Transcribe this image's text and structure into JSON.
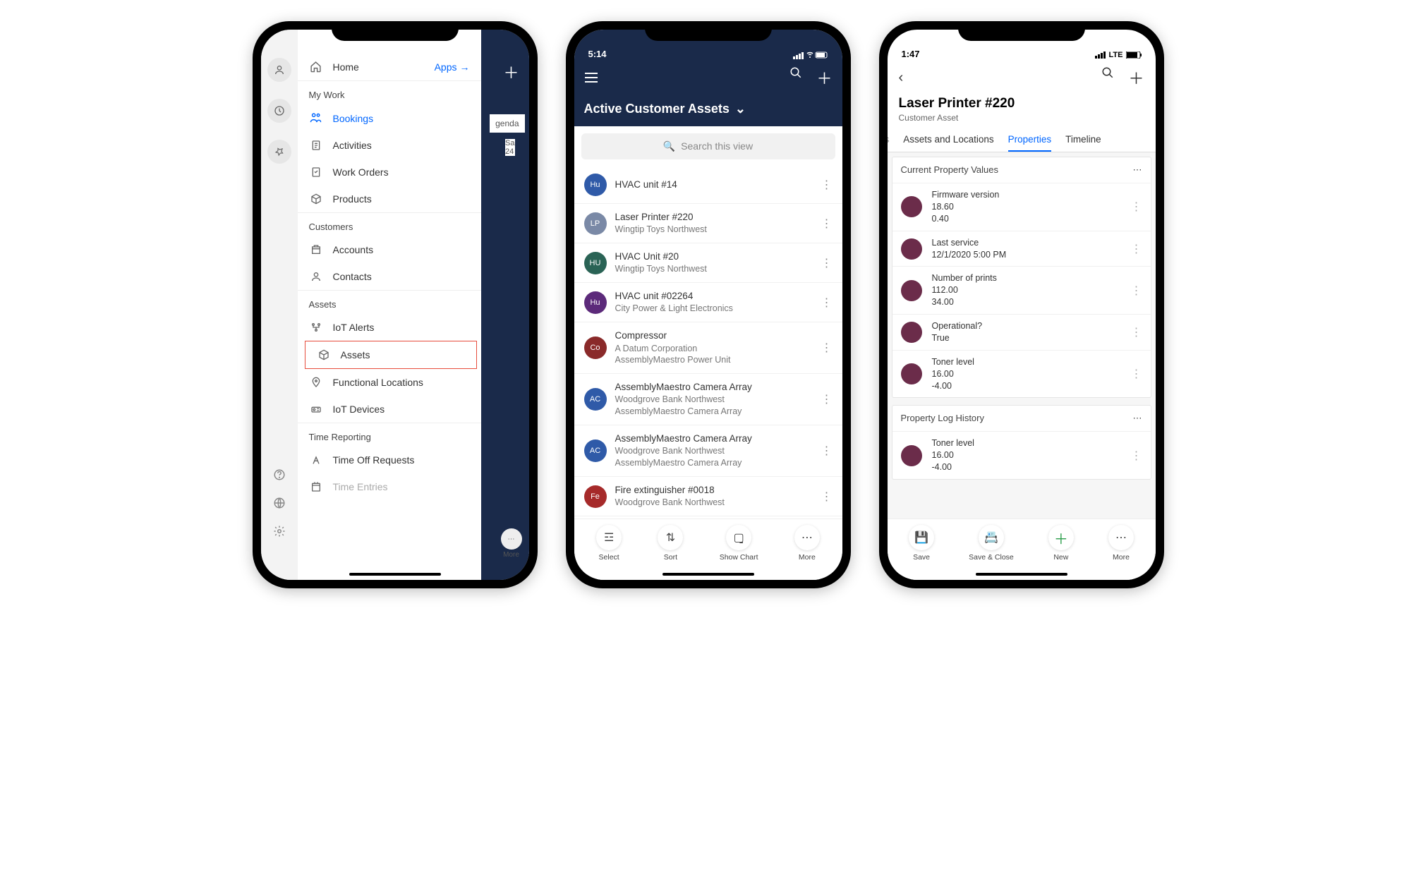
{
  "phone1": {
    "apps_link": "Apps",
    "drawer": {
      "top_item": "Home",
      "sections": [
        {
          "title": "My Work",
          "items": [
            "Bookings",
            "Activities",
            "Work Orders",
            "Products"
          ]
        },
        {
          "title": "Customers",
          "items": [
            "Accounts",
            "Contacts"
          ]
        },
        {
          "title": "Assets",
          "items": [
            "IoT Alerts",
            "Assets",
            "Functional Locations",
            "IoT Devices"
          ]
        },
        {
          "title": "Time Reporting",
          "items": [
            "Time Off Requests",
            "Time Entries"
          ]
        }
      ],
      "selected_item": "Bookings",
      "highlighted_item": "Assets"
    },
    "background": {
      "agenda": "genda",
      "sa": "Sa",
      "sa_num": "24",
      "more": "More"
    }
  },
  "phone2": {
    "status_time": "5:14",
    "title": "Active Customer Assets",
    "search_placeholder": "Search this view",
    "items": [
      {
        "avatar": "Hu",
        "color": "#2f5aa8",
        "title": "HVAC unit #14",
        "subtitle": ""
      },
      {
        "avatar": "LP",
        "color": "#7a89a6",
        "title": "Laser Printer #220",
        "subtitle": "Wingtip Toys Northwest"
      },
      {
        "avatar": "HU",
        "color": "#2a6355",
        "title": "HVAC Unit #20",
        "subtitle": "Wingtip Toys Northwest"
      },
      {
        "avatar": "Hu",
        "color": "#5c2a7a",
        "title": "HVAC unit #02264",
        "subtitle": "City Power & Light Electronics"
      },
      {
        "avatar": "Co",
        "color": "#8a2a2a",
        "title": "Compressor",
        "subtitle": "A Datum Corporation",
        "subtitle2": "AssemblyMaestro Power Unit"
      },
      {
        "avatar": "AC",
        "color": "#2f5aa8",
        "title": "AssemblyMaestro Camera Array",
        "subtitle": "Woodgrove Bank Northwest",
        "subtitle2": "AssemblyMaestro Camera Array"
      },
      {
        "avatar": "AC",
        "color": "#2f5aa8",
        "title": "AssemblyMaestro Camera Array",
        "subtitle": "Woodgrove Bank Northwest",
        "subtitle2": "AssemblyMaestro Camera Array"
      },
      {
        "avatar": "Fe",
        "color": "#a62a2a",
        "title": "Fire extinguisher #0018",
        "subtitle": "Woodgrove Bank Northwest"
      }
    ],
    "bottom_actions": [
      "Select",
      "Sort",
      "Show Chart",
      "More"
    ]
  },
  "phone3": {
    "status_time": "1:47",
    "status_net": "LTE",
    "title": "Laser Printer #220",
    "subtitle": "Customer Asset",
    "tabs_cut": "ers",
    "tabs": [
      "Assets and Locations",
      "Properties",
      "Timeline"
    ],
    "active_tab": "Properties",
    "card1_title": "Current Property Values",
    "properties": [
      {
        "label": "Firmware version",
        "v1": "18.60",
        "v2": "0.40"
      },
      {
        "label": "Last service",
        "v1": "12/1/2020 5:00 PM",
        "v2": ""
      },
      {
        "label": "Number of prints",
        "v1": "112.00",
        "v2": "34.00"
      },
      {
        "label": "Operational?",
        "v1": "True",
        "v2": ""
      },
      {
        "label": "Toner level",
        "v1": "16.00",
        "v2": "-4.00"
      }
    ],
    "card2_title": "Property Log History",
    "history": [
      {
        "label": "Toner level",
        "v1": "16.00",
        "v2": "-4.00"
      }
    ],
    "bottom_actions": [
      "Save",
      "Save & Close",
      "New",
      "More"
    ]
  }
}
